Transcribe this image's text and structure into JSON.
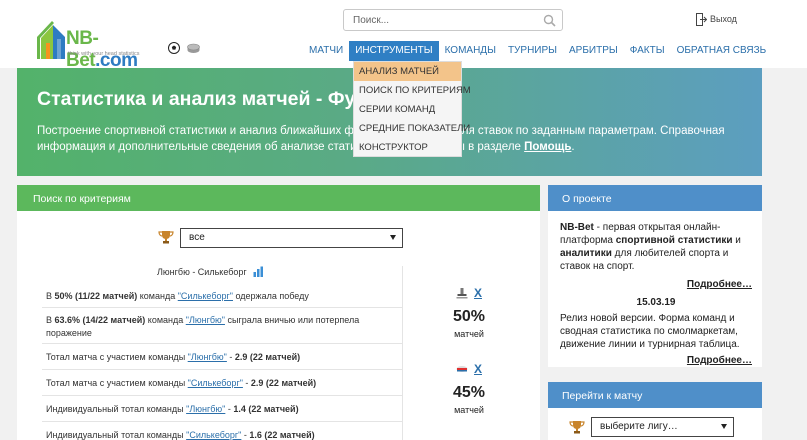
{
  "header": {
    "logo_main": "NB-Bet",
    "logo_tld": ".com",
    "logo_tagline": "think with your head statistics",
    "search_placeholder": "Поиск...",
    "logout_label": "Выход"
  },
  "nav": {
    "items": [
      {
        "label": "Матчи",
        "active": false
      },
      {
        "label": "Инструменты",
        "active": true
      },
      {
        "label": "Команды",
        "active": false
      },
      {
        "label": "Турниры",
        "active": false
      },
      {
        "label": "Арбитры",
        "active": false
      },
      {
        "label": "Факты",
        "active": false
      },
      {
        "label": "Обратная связь",
        "active": false
      }
    ]
  },
  "dropdown": {
    "items": [
      {
        "label": "Анализ матчей",
        "hover": true
      },
      {
        "label": "Поиск по критериям",
        "hover": false
      },
      {
        "label": "Серии команд",
        "hover": false
      },
      {
        "label": "Средние показатели",
        "hover": false
      },
      {
        "label": "Конструктор",
        "hover": false
      }
    ]
  },
  "hero": {
    "title": "Статистика и анализ матчей - Фу",
    "lead_part1": "Построение спортивной статистики и анализ ближайших футбольных матчей для ставок по заданным параметрам. Справочная информация и дополнительные сведения об анализе статистики представлены в разделе ",
    "lead_link": "Помощь",
    "lead_end": "."
  },
  "criteria_panel": {
    "title": "Поиск по критериям",
    "select_value": "все",
    "match_title": "Люнгбю - Силькеборг",
    "rows": [
      {
        "pre": "В ",
        "bold": "50% (11/22 матчей)",
        "mid": " команда ",
        "team": "\"Силькеборг\"",
        "post": " одержала победу"
      },
      {
        "pre": "В ",
        "bold": "63.6% (14/22 матчей)",
        "mid": " команда ",
        "team": "\"Люнгбю\"",
        "post": " сыграла вничью или потерпела поражение"
      },
      {
        "pre": "Тотал матча с участием команды ",
        "team": "\"Люнгбю\"",
        "bold": "2.9 (22 матчей)",
        "mid": " - "
      },
      {
        "pre": "Тотал матча с участием команды ",
        "team": "\"Силькеборг\"",
        "bold": "2.9 (22 матчей)",
        "mid": " - "
      },
      {
        "pre": "Индивидуальный тотал команды ",
        "team": "\"Люнгбю\"",
        "bold": "1.4 (22 матчей)",
        "mid": " - "
      },
      {
        "pre": "Индивидуальный тотал команды ",
        "team": "\"Силькеборг\"",
        "bold": "1.6 (22 матчей)",
        "mid": " - "
      }
    ],
    "predictions": [
      {
        "outcome": "X",
        "percent": "50%",
        "label": "матчей"
      },
      {
        "outcome": "X",
        "percent": "45%",
        "label": "матчей"
      }
    ]
  },
  "about_panel": {
    "title": "О проекте",
    "brand": "NB-Bet",
    "text1": " - первая открытая онлайн-платформа ",
    "bold1": "спортивной статистики",
    "text2": " и ",
    "bold2": "аналитики",
    "text3": " для любителей спорта и ставок на спорт.",
    "more1": "Подробнее…",
    "news_date": "15.03.19",
    "news_text": "Релиз новой версии. Форма команд и сводная статистика по смолмаркетам, движение линии и турнирная таблица.",
    "more2": "Подробнее…"
  },
  "goto_panel": {
    "title": "Перейти к матчу",
    "select_value": "выберите лигу…"
  },
  "colors": {
    "nav_link": "#2b6faa",
    "nav_active": "#2f7fc4",
    "dropdown_hover": "#f3c48a",
    "panel_green": "#5cb85c",
    "panel_blue": "#4f8fc9"
  }
}
